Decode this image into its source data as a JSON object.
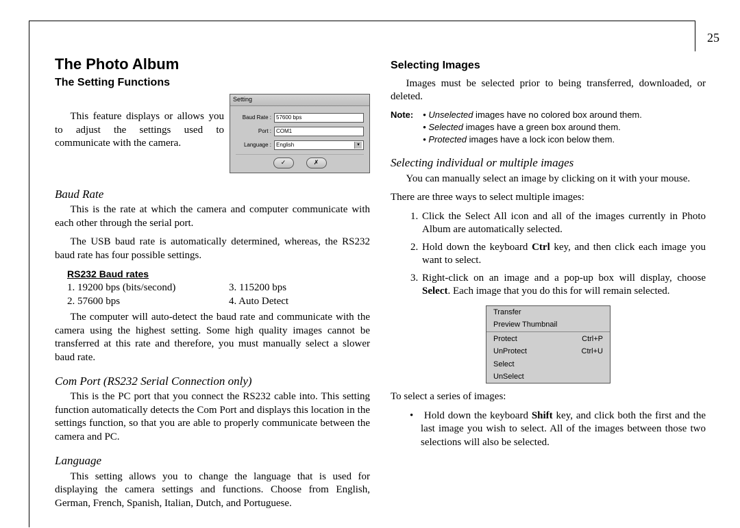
{
  "pageNumber": "25",
  "left": {
    "title": "The Photo Album",
    "subtitle": "The Setting Functions",
    "introText": "This feature displays or allows you to adjust the settings used to communicate with the camera.",
    "dialog": {
      "title": "Setting",
      "rows": {
        "baudLabel": "Baud Rate :",
        "baudValue": "57600 bps",
        "portLabel": "Port :",
        "portValue": "COM1",
        "langLabel": "Language :",
        "langValue": "English"
      },
      "okGlyph": "✓",
      "cancelGlyph": "✗"
    },
    "baud": {
      "heading": "Baud Rate",
      "p1": "This is the rate at which the camera and computer communicate with each other through the serial port.",
      "p2": "The USB baud rate is automatically determined, whereas, the RS232 baud rate has four possible settings.",
      "tableHead": "RS232 Baud rates",
      "r1": "1. 19200 bps (bits/second)",
      "r3": "3. 115200 bps",
      "r2": "2. 57600 bps",
      "r4": "4. Auto Detect",
      "p3": "The computer will auto-detect the baud rate and communicate with the camera using the highest setting. Some high quality images cannot be transferred at this rate and therefore, you must manually select a slower baud rate."
    },
    "comPort": {
      "heading": "Com Port (RS232 Serial Connection only)",
      "p1": "This is the PC port that you connect the RS232 cable into. This setting function automatically detects the Com Port and displays this location in the settings function, so that you are able to properly communicate between the camera and PC."
    },
    "language": {
      "heading": "Language",
      "p1": "This setting allows you to change the language that is used for displaying the camera settings and functions.  Choose from English, German, French, Spanish, Italian, Dutch, and Portuguese."
    }
  },
  "right": {
    "title": "Selecting Images",
    "intro": "Images must be selected prior to being transferred, downloaded, or deleted.",
    "noteLabel": "Note:",
    "note1a": "Unselected",
    "note1b": " images have no colored box around them.",
    "note2a": "Selected",
    "note2b": " images have a green box around them.",
    "note3a": "Protected",
    "note3b": " images have a lock icon below them.",
    "subheading": "Selecting individual or multiple images",
    "p1": "You can manually select an image by clicking on it with your mouse.",
    "p2": "There are three ways to select multiple images:",
    "li1": "Click the Select All icon and all of the images currently in Photo Album are automatically selected.",
    "li2a": "Hold down the keyboard ",
    "li2b": "Ctrl",
    "li2c": " key, and then click each image you want to select.",
    "li3a": "Right-click on an image and a pop-up box will display, choose ",
    "li3b": "Select",
    "li3c": ".  Each image that you do this for will remain selected.",
    "menu": {
      "transfer": "Transfer",
      "preview": "Preview Thumbnail",
      "protect": "Protect",
      "protectKey": "Ctrl+P",
      "unprotect": "UnProtect",
      "unprotectKey": "Ctrl+U",
      "select": "Select",
      "unselect": "UnSelect"
    },
    "p3": "To select a series of images:",
    "series_a": "Hold down the keyboard ",
    "series_b": "Shift",
    "series_c": " key, and click both the first and the last image you wish to select. All of the images between those two selections will also be selected."
  }
}
